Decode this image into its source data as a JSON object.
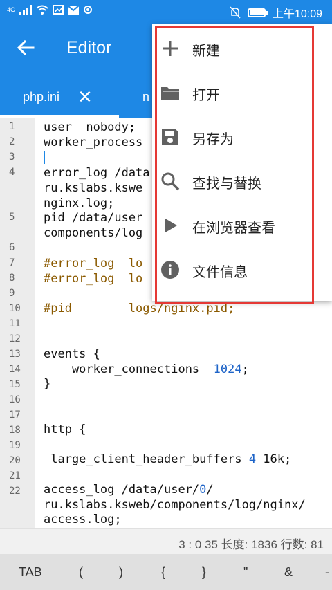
{
  "status_bar": {
    "left_text": "4G",
    "time": "上午10:09"
  },
  "app_bar": {
    "title": "Editor",
    "active_tab": "php.ini",
    "second_tab_partial": "n"
  },
  "editor": {
    "line_numbers": [
      "1",
      "2",
      "3",
      "4",
      "5",
      "6",
      "7",
      "8",
      "9",
      "10",
      "11",
      "12",
      "13",
      "14",
      "15",
      "16",
      "17",
      "18",
      "19",
      "20",
      "21",
      "22"
    ],
    "code_lines": [
      "user  nobody;",
      "worker_process",
      "",
      "error_log /data",
      "ru.kslabs.kswe",
      "nginx.log;",
      "pid /data/user",
      "components/log",
      "",
      "#error_log  lo",
      "#error_log  lo",
      "",
      "#pid        logs/nginx.pid;",
      "",
      "",
      "events {",
      "    worker_connections  ",
      "}",
      "",
      "",
      "http {",
      "",
      " large_client_header_buffers ",
      "",
      "access_log /data/user/",
      "ru.kslabs.ksweb/components/log/nginx/",
      "access.log;"
    ],
    "number_tokens": [
      "1024",
      "4",
      "0"
    ],
    "suffix_tokens": [
      ";",
      " 16k;",
      "/"
    ]
  },
  "footer": {
    "text": "3 : 0  35  长度: 1836  行数: 81"
  },
  "keys": [
    "TAB",
    "(",
    ")",
    "{",
    "}",
    "\"",
    "&",
    "-"
  ],
  "menu": {
    "items": [
      {
        "icon": "plus-icon",
        "label": "新建"
      },
      {
        "icon": "folder-icon",
        "label": "打开"
      },
      {
        "icon": "save-icon",
        "label": "另存为"
      },
      {
        "icon": "search-icon",
        "label": "查找与替换"
      },
      {
        "icon": "play-icon",
        "label": "在浏览器查看"
      },
      {
        "icon": "info-icon",
        "label": "文件信息"
      }
    ]
  },
  "colors": {
    "primary": "#1e88e5",
    "highlight_border": "#e53935",
    "comment": "#8b5a00",
    "number": "#1e64c8"
  }
}
